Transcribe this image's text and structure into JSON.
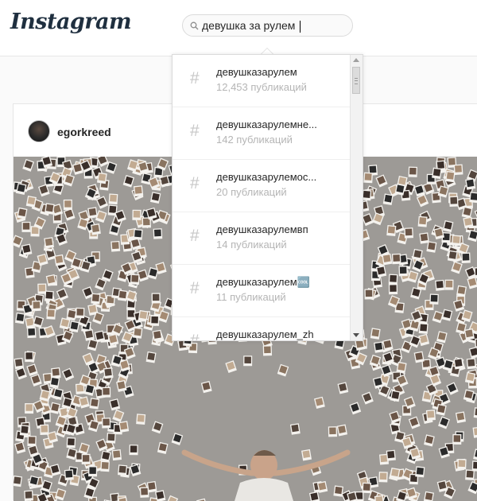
{
  "header": {
    "logo_text": "Instagram",
    "search": {
      "value": "девушка за рулем",
      "icon": "search-icon"
    }
  },
  "post": {
    "username": "egorkreed"
  },
  "dropdown": {
    "results": [
      {
        "name": "девушказарулем",
        "count": "12,453 публикаций"
      },
      {
        "name": "девушказарулемне...",
        "count": "142 публикаций"
      },
      {
        "name": "девушказарулемос...",
        "count": "20 публикаций"
      },
      {
        "name": "девушказарулемвп",
        "count": "14 публикаций"
      },
      {
        "name": "девушказарулем🆒",
        "count": "11 публикаций"
      },
      {
        "name": "девушказарулем_zh",
        "count": ""
      }
    ],
    "hash_symbol": "#"
  },
  "colors": {
    "accent": "#003569",
    "muted": "#b5b5b5",
    "border": "#dbdbdb"
  }
}
